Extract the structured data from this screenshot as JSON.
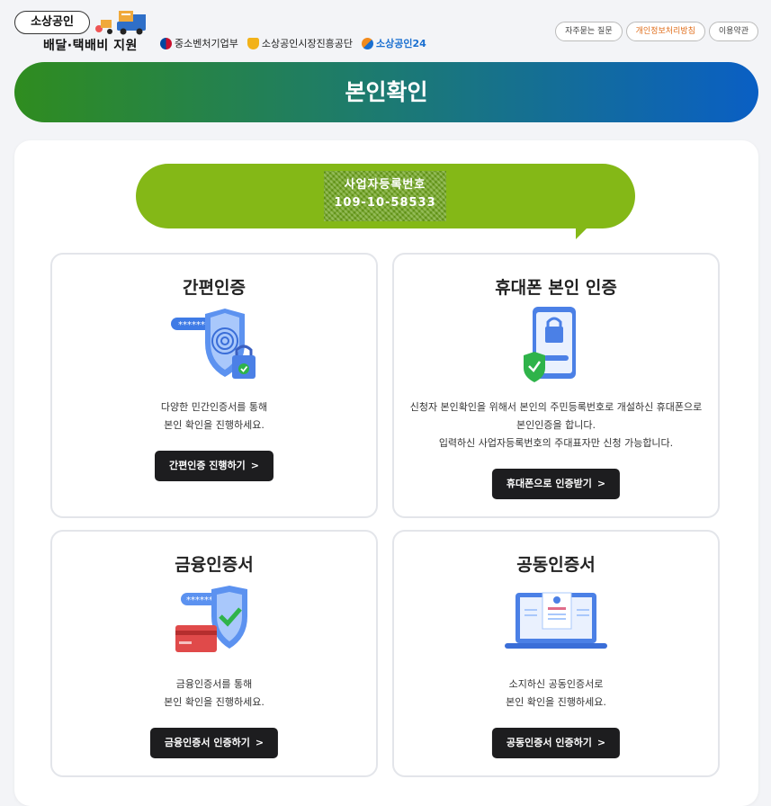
{
  "header": {
    "logo_title": "소상공인",
    "logo_subtitle": "배달·택배비 지원",
    "partners": [
      {
        "name": "중소벤처기업부",
        "icon": "taegeuk-icon"
      },
      {
        "name": "소상공인시장진흥공단",
        "icon": "agency-shield-icon"
      },
      {
        "name": "소상공인24",
        "icon": "sbiz24-logo-icon"
      }
    ],
    "links": [
      "자주묻는 질문",
      "개인정보처리방침",
      "이용약관"
    ]
  },
  "banner": {
    "title": "본인확인"
  },
  "notice": {
    "line1": "사업자등록번호",
    "line2": "109-10-58533"
  },
  "cards": [
    {
      "title": "간편인증",
      "desc": [
        "다양한 민간인증서를 통해",
        "본인 확인을 진행하세요."
      ],
      "button": "간편인증 진행하기",
      "icon": "fingerprint-shield-lock-icon"
    },
    {
      "title": "휴대폰 본인 인증",
      "desc": [
        "신청자 본인확인을 위해서 본인의 주민등록번호로 개설하신 휴대폰으로",
        "본인인증을 합니다.",
        "입력하신 사업자등록번호의 주대표자만 신청 가능합니다."
      ],
      "button": "휴대폰으로 인증받기",
      "icon": "phone-lock-shield-icon"
    },
    {
      "title": "금융인증서",
      "desc": [
        "금융인증서를 통해",
        "본인 확인을 진행하세요."
      ],
      "button": "금융인증서 인증하기",
      "icon": "card-shield-check-icon"
    },
    {
      "title": "공동인증서",
      "desc": [
        "소지하신 공동인증서로",
        "본인 확인을 진행하세요."
      ],
      "button": "공동인증서 인증하기",
      "icon": "laptop-certificate-icon"
    }
  ],
  "colors": {
    "banner_start": "#2f8c1f",
    "banner_end": "#0a5fc4",
    "bubble": "#84b817",
    "button": "#1d1d1f",
    "accent_link": "#e06d1a"
  }
}
